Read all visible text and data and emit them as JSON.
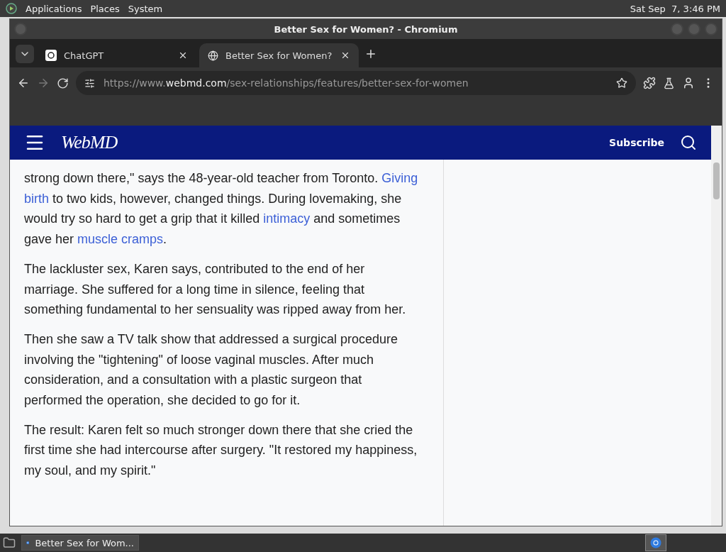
{
  "desktop_panel": {
    "menus": [
      "Applications",
      "Places",
      "System"
    ],
    "clock": "Sat Sep  7, 3:46 PM"
  },
  "window": {
    "title": "Better Sex for Women? - Chromium",
    "tabs": [
      {
        "label": "ChatGPT",
        "selected": false,
        "kind": "chatgpt"
      },
      {
        "label": "Better Sex for Women?",
        "selected": true,
        "kind": "globe"
      }
    ],
    "url": {
      "scheme": "https://www.",
      "domain": "webmd.com",
      "path": "/sex-relationships/features/better-sex-for-women"
    }
  },
  "page": {
    "logo": "WebMD",
    "subscribe": "Subscribe",
    "paragraphs": [
      [
        {
          "text": "strong down there,\" says the 48-year-old teacher from Toronto. ",
          "link": false
        },
        {
          "text": "Giving ",
          "link": true
        },
        {
          "text": "birth",
          "link": true
        },
        {
          "text": " to two kids, however, changed things. During lovemaking, she would try so hard to get a grip that it killed ",
          "link": false
        },
        {
          "text": "intimacy",
          "link": true
        },
        {
          "text": " and sometimes gave her ",
          "link": false
        },
        {
          "text": "muscle cramps",
          "link": true
        },
        {
          "text": ".",
          "link": false
        }
      ],
      [
        {
          "text": "The lackluster sex, Karen says, contributed to the end of her marriage. She suffered for a long time in silence, feeling that something fundamental to her sensuality was ripped away from her.",
          "link": false
        }
      ],
      [
        {
          "text": "Then she saw a TV talk show that addressed a surgical procedure involving the \"tightening\" of loose vaginal muscles. After much consideration, and a consultation with a plastic surgeon that performed the operation, she decided to go for it.",
          "link": false
        }
      ],
      [
        {
          "text": "The result: Karen felt so much stronger down there that she cried the first time she had intercourse after surgery. \"It restored my happiness, my soul, and my spirit.\"",
          "link": false
        }
      ]
    ]
  },
  "taskbar": {
    "items": [
      {
        "label": "Better Sex for Wom...",
        "selected": false
      }
    ]
  }
}
